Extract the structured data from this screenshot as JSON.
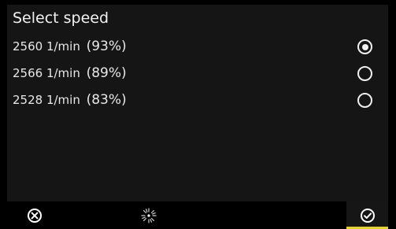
{
  "dialog": {
    "title": "Select speed"
  },
  "options": [
    {
      "speed": "2560 1/min",
      "percent": "(93%)",
      "selected": true
    },
    {
      "speed": "2566 1/min",
      "percent": "(89%)",
      "selected": false
    },
    {
      "speed": "2528 1/min",
      "percent": "(83%)",
      "selected": false
    }
  ],
  "footer": {
    "cancel_icon": "close-circle-icon",
    "busy_icon": "loading-spinner-icon",
    "confirm_icon": "check-circle-icon"
  },
  "colors": {
    "background": "#000000",
    "panel": "#151515",
    "text": "#f2f2f2",
    "accent": "#e4d32a"
  }
}
